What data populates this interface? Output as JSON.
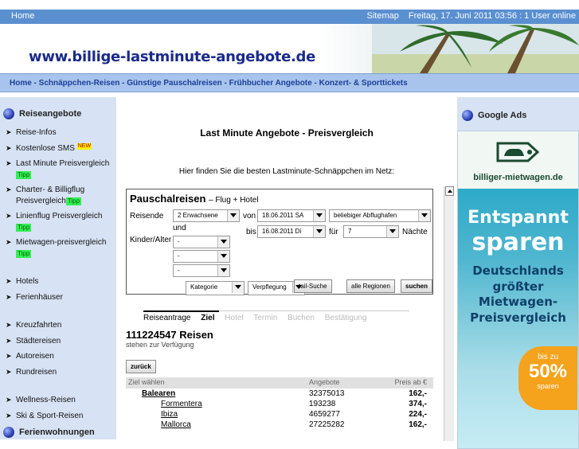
{
  "topbar": {
    "home": "Home",
    "sitemap": "Sitemap",
    "date": "Freitag, 17. Juni 2011 03:56 : 1 User online"
  },
  "banner": {
    "site": "www.billige-lastminute-angebote.de"
  },
  "nav": {
    "items": "Home - Schnäppchen-Reisen - Günstige Pauschalreisen - Frühbucher Angebote - Konzert- & Sporttickets"
  },
  "sidebar": {
    "title": "Reiseangebote",
    "items": [
      {
        "label": "Reise-Infos"
      },
      {
        "label": "Kostenlose SMS",
        "badge": "NEW"
      },
      {
        "label": "Last Minute Preisvergleich",
        "tipp": "Tipp"
      },
      {
        "label": "Charter- & Billigflug Preisvergleich",
        "tipp": "Tipp"
      },
      {
        "label": "Linienflug Preisvergleich",
        "tipp": "Tipp"
      },
      {
        "label": "Mietwagen-preisvergleich",
        "tipp": "Tipp"
      },
      {
        "label": "Hotels"
      },
      {
        "label": "Ferienhäuser"
      },
      {
        "label": "Kreuzfahrten"
      },
      {
        "label": "Städtereisen"
      },
      {
        "label": "Autoreisen"
      },
      {
        "label": "Rundreisen"
      },
      {
        "label": "Wellness-Reisen"
      },
      {
        "label": "Ski & Sport-Reisen"
      }
    ],
    "title2": "Ferienwohnungen"
  },
  "main": {
    "heading": "Last Minute Angebote - Preisvergleich",
    "intro": "Hier finden Sie die besten Lastminute-Schnäppchen im Netz:",
    "form": {
      "title": "Pauschalreisen",
      "subtitle": "– Flug + Hotel",
      "reisende_label": "Reisende",
      "reisende_value": "2 Erwachsene",
      "von_label": "von",
      "von_value": "18.06.2011 SA",
      "abflug_value": "beliebiger Abflughafen",
      "und_label": "und",
      "kinder_label": "Kinder/Alter",
      "bis_label": "bis",
      "bis_value": "16.08.2011 Di",
      "fuer_label": "für",
      "naechte_value": "7",
      "naechte_label": "Nächte",
      "kind1": "-",
      "kind2": "-",
      "kind3": "-",
      "kategorie": "Kategorie",
      "verpflegung": "Verpflegung",
      "detail_suche": "tail-Suche",
      "alle_regionen": "alle Regionen",
      "suchen": "suchen"
    },
    "steps": {
      "s1": "Reiseantrage",
      "s2": "Ziel",
      "s3": "Hotel",
      "s4": "Termin",
      "s5": "Buchen",
      "s6": "Bestätigung"
    },
    "result_count": "111224547 Reisen",
    "result_sub": "stehen zur Verfügung",
    "back": "zurück",
    "table": {
      "h1": "Ziel wählen",
      "h2": "Angebote",
      "h3": "Preis ab €",
      "rows": [
        {
          "ziel": "Balearen",
          "angebote": "32375013",
          "preis": "162,-"
        },
        {
          "ziel": "Formentera",
          "angebote": "193238",
          "preis": "374,-"
        },
        {
          "ziel": "Ibiza",
          "angebote": "4659277",
          "preis": "224,-"
        },
        {
          "ziel": "Mallorca",
          "angebote": "27225282",
          "preis": "162,-"
        }
      ]
    }
  },
  "right": {
    "title": "Google Ads",
    "ad_logo": "billiger-mietwagen.de",
    "ad_line1": "Entspannt",
    "ad_line2": "sparen",
    "ad_mid": "Deutschlands größter Mietwagen-Preisvergleich",
    "ad_badge1": "bis zu",
    "ad_badge2": "50%",
    "ad_badge3": "sparen"
  }
}
